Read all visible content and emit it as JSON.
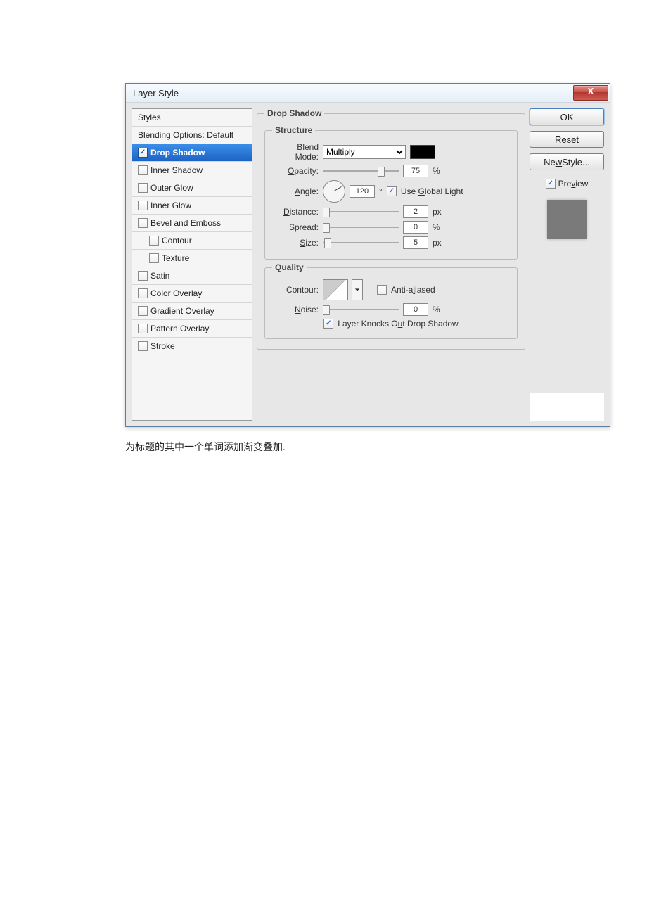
{
  "dialog": {
    "title": "Layer Style",
    "close_x": "X"
  },
  "sidebar": {
    "header": "Styles",
    "blending": "Blending Options: Default",
    "items": [
      {
        "label": "Drop Shadow",
        "checked": true,
        "selected": true
      },
      {
        "label": "Inner Shadow",
        "checked": false
      },
      {
        "label": "Outer Glow",
        "checked": false
      },
      {
        "label": "Inner Glow",
        "checked": false
      },
      {
        "label": "Bevel and Emboss",
        "checked": false
      },
      {
        "label": "Contour",
        "checked": false,
        "sub": true
      },
      {
        "label": "Texture",
        "checked": false,
        "sub": true
      },
      {
        "label": "Satin",
        "checked": false
      },
      {
        "label": "Color Overlay",
        "checked": false
      },
      {
        "label": "Gradient Overlay",
        "checked": false
      },
      {
        "label": "Pattern Overlay",
        "checked": false
      },
      {
        "label": "Stroke",
        "checked": false
      }
    ]
  },
  "main": {
    "group_title": "Drop Shadow",
    "structure_title": "Structure",
    "blend_mode_label": "Blend Mode:",
    "blend_mode_value": "Multiply",
    "opacity_label": "Opacity:",
    "opacity_value": "75",
    "percent": "%",
    "angle_label": "Angle:",
    "angle_value": "120",
    "degree": "°",
    "global_light_label": "Use Global Light",
    "distance_label": "Distance:",
    "distance_value": "2",
    "px": "px",
    "spread_label": "Spread:",
    "spread_value": "0",
    "size_label": "Size:",
    "size_value": "5",
    "quality_title": "Quality",
    "contour_label": "Contour:",
    "antialias_label": "Anti-aliased",
    "noise_label": "Noise:",
    "noise_value": "0",
    "knockout_label": "Layer Knocks Out Drop Shadow"
  },
  "buttons": {
    "ok": "OK",
    "reset": "Reset",
    "new_style": "New Style...",
    "preview": "Preview"
  },
  "caption": "为标题的其中一个单词添加渐变叠加."
}
